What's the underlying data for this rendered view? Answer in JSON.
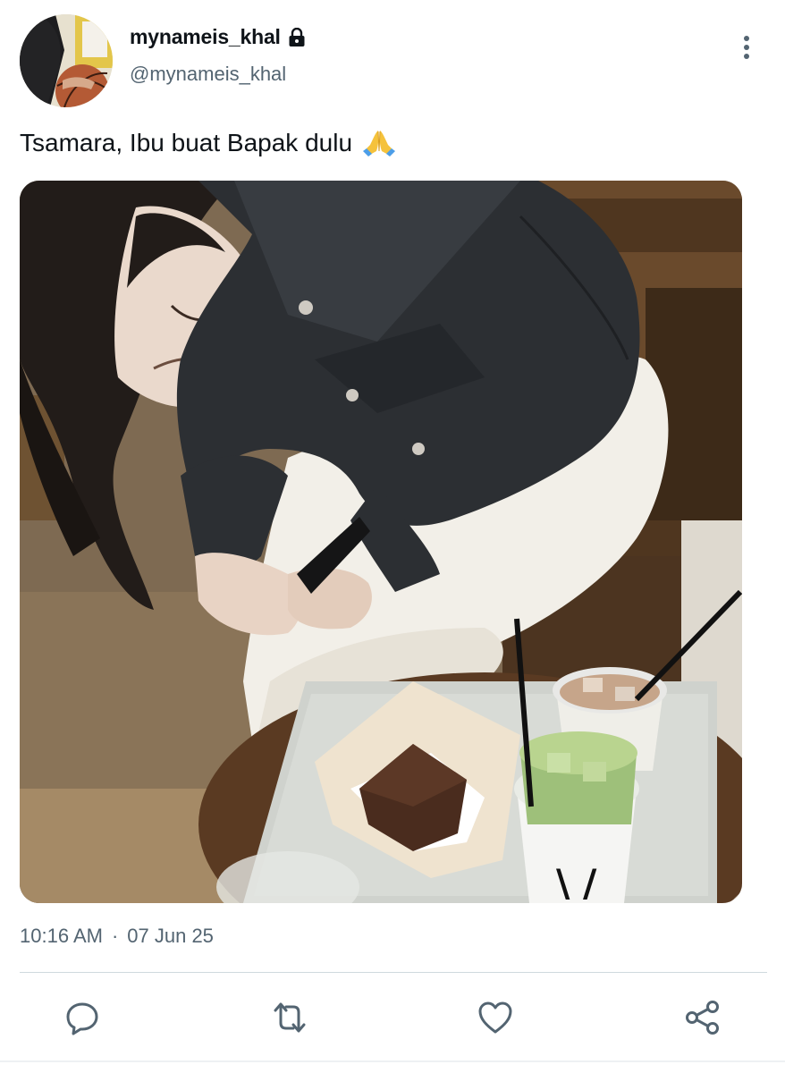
{
  "tweet": {
    "display_name": "mynameis_khal",
    "handle": "@mynameis_khal",
    "text": "Tsamara, Ibu buat Bapak dulu",
    "time": "10:16 AM",
    "separator": "·",
    "date": "07 Jun 25"
  },
  "icons": {
    "protected": "lock-icon",
    "more": "more-vertical-icon",
    "emoji": "folded-hands-emoji",
    "reply": "reply-icon",
    "retweet": "retweet-icon",
    "like": "heart-icon",
    "share": "share-icon"
  },
  "colors": {
    "text_primary": "#0f1419",
    "text_secondary": "#536471",
    "divider": "#cfd9de"
  }
}
